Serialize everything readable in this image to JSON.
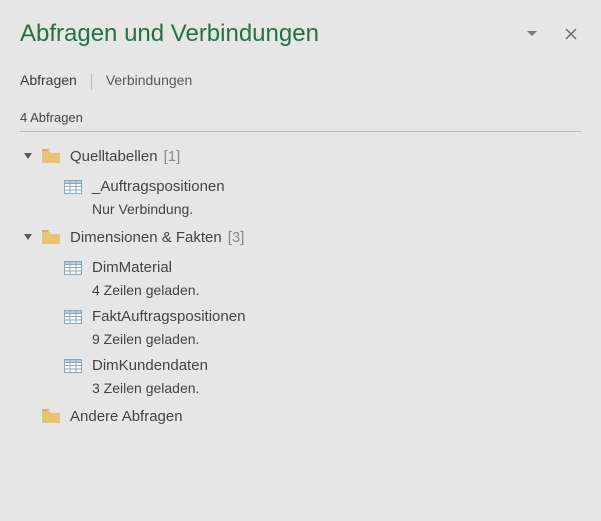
{
  "header": {
    "title": "Abfragen und Verbindungen"
  },
  "tabs": {
    "queries_label": "Abfragen",
    "connections_label": "Verbindungen"
  },
  "count_line": "4 Abfragen",
  "groups": [
    {
      "expanded": true,
      "name": "Quelltabellen",
      "count_display": "[1]",
      "items": [
        {
          "name": "_Auftragspositionen",
          "status": "Nur Verbindung."
        }
      ]
    },
    {
      "expanded": true,
      "name": "Dimensionen & Fakten",
      "count_display": "[3]",
      "items": [
        {
          "name": "DimMaterial",
          "status": "4 Zeilen geladen."
        },
        {
          "name": "FaktAuftragspositionen",
          "status": "9 Zeilen geladen."
        },
        {
          "name": "DimKundendaten",
          "status": "3 Zeilen geladen."
        }
      ]
    },
    {
      "expanded": false,
      "name": "Andere Abfragen",
      "count_display": "",
      "items": []
    }
  ]
}
